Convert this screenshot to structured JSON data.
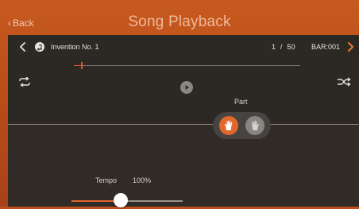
{
  "header": {
    "back_label": "Back",
    "title": "Song Playback"
  },
  "song": {
    "name": "Invention No. 1",
    "current": "1",
    "separator": "/",
    "total": "50",
    "bar": "BAR:001"
  },
  "playback": {
    "progress_fraction": 0.035
  },
  "tempo": {
    "label": "Tempo",
    "value": "100%",
    "slider_fraction": 0.44
  },
  "part": {
    "label": "Part",
    "right_hand_active": true,
    "left_hand_active": false
  },
  "colors": {
    "accent": "#e2672d",
    "header_bg": "#c65a1e",
    "panel_bg": "#2e2a26",
    "text": "#e8e2dc"
  },
  "icons": {
    "back": "chevron-left-icon",
    "prev": "chevron-left-icon",
    "next": "chevron-right-icon",
    "song": "music-note-icon",
    "repeat": "repeat-icon",
    "shuffle": "shuffle-icon",
    "play": "play-icon",
    "right_hand": "right-hand-icon",
    "left_hand": "left-hand-icon"
  }
}
